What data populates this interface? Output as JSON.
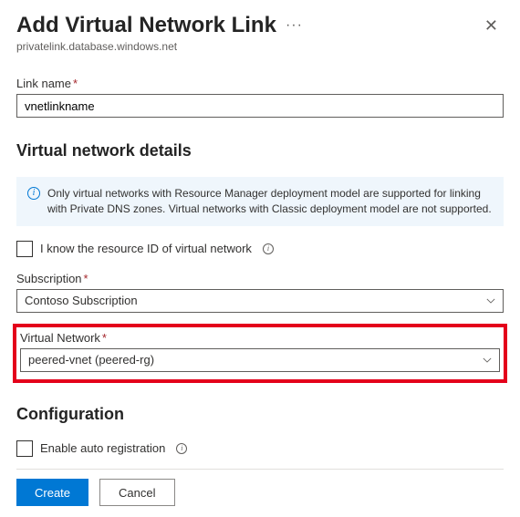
{
  "header": {
    "title": "Add Virtual Network Link",
    "subtitle": "privatelink.database.windows.net"
  },
  "link_name": {
    "label": "Link name",
    "value": "vnetlinkname"
  },
  "section_vnet_details": "Virtual network details",
  "info_message": "Only virtual networks with Resource Manager deployment model are supported for linking with Private DNS zones. Virtual networks with Classic deployment model are not supported.",
  "know_resource_id_label": "I know the resource ID of virtual network",
  "subscription": {
    "label": "Subscription",
    "value": "Contoso Subscription"
  },
  "virtual_network": {
    "label": "Virtual Network",
    "value": "peered-vnet (peered-rg)"
  },
  "section_configuration": "Configuration",
  "enable_auto_reg_label": "Enable auto registration",
  "buttons": {
    "create": "Create",
    "cancel": "Cancel"
  }
}
